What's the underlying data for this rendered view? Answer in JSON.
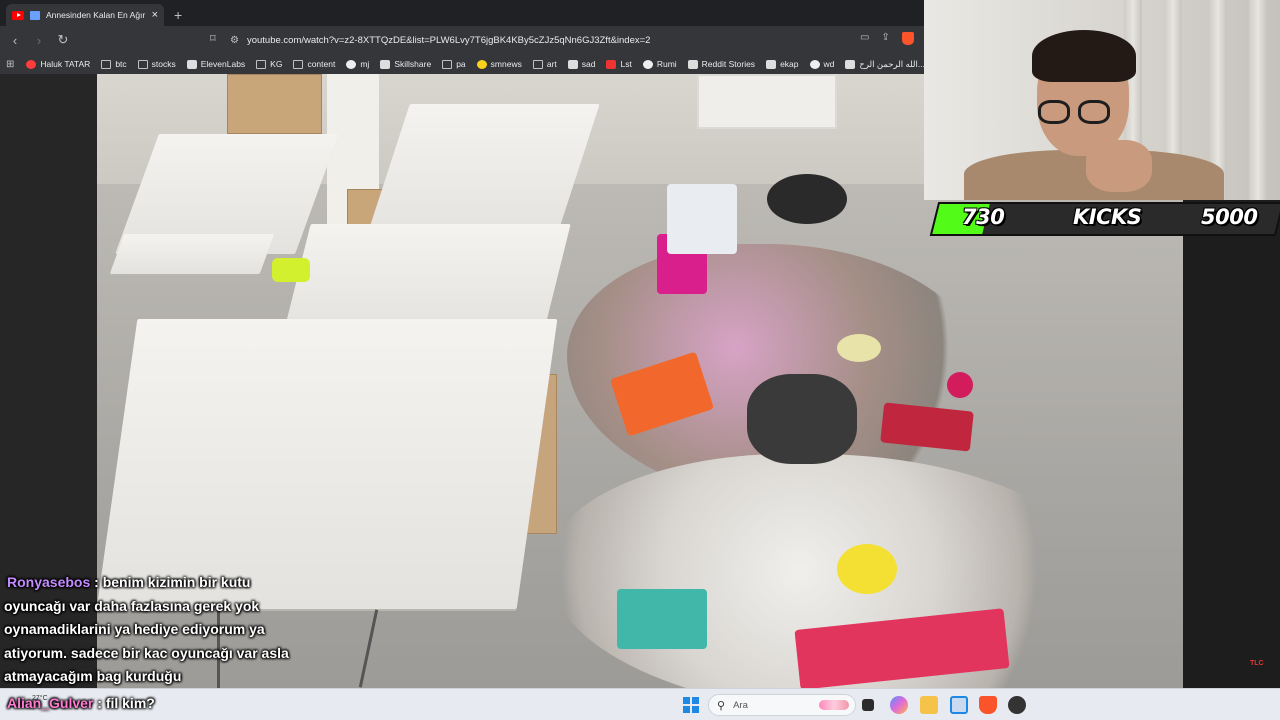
{
  "browser": {
    "tab_title": "Annesinden Kalan En Ağır Mi...",
    "url": "youtube.com/watch?v=z2-8XTTQzDE&list=PLW6Lvy7T6jgBK4KBy5cZJz5qNn6GJ3Zft&index=2",
    "bookmarks": [
      "Haluk TATAR",
      "btc",
      "stocks",
      "ElevenLabs",
      "KG",
      "content",
      "mj",
      "Skillshare",
      "pa",
      "smnews",
      "art",
      "sad",
      "Lst",
      "Rumi",
      "Reddit Stories",
      "ekap",
      "wd",
      "الله الرحمن الرح..."
    ]
  },
  "goal": {
    "current": "730",
    "label": "KICKS",
    "target": "5000",
    "progress_fraction": 0.146,
    "fill_color": "#53fc18"
  },
  "chat": [
    {
      "user": "Ronyasebos",
      "lines": [
        ": benim kizimin bir kutu",
        "oyuncağı var daha fazlasına gerek yok",
        "oynamadiklarini ya hediye ediyorum ya",
        "atiyorum. sadece bir kac oyuncağı var asla",
        "atmayacağım bag kurduğu"
      ]
    },
    {
      "user": "Alian_Gulver",
      "lines": [
        ": fil kim?"
      ]
    }
  ],
  "video_badge": "TLC",
  "taskbar": {
    "weather": "27°C",
    "search_placeholder": "Ara"
  },
  "icons": {
    "back": "←",
    "forward": "→",
    "reload": "↻",
    "bookmark": "☆",
    "apps": "⊞",
    "close": "×",
    "new_tab": "+",
    "search": "⚲"
  }
}
